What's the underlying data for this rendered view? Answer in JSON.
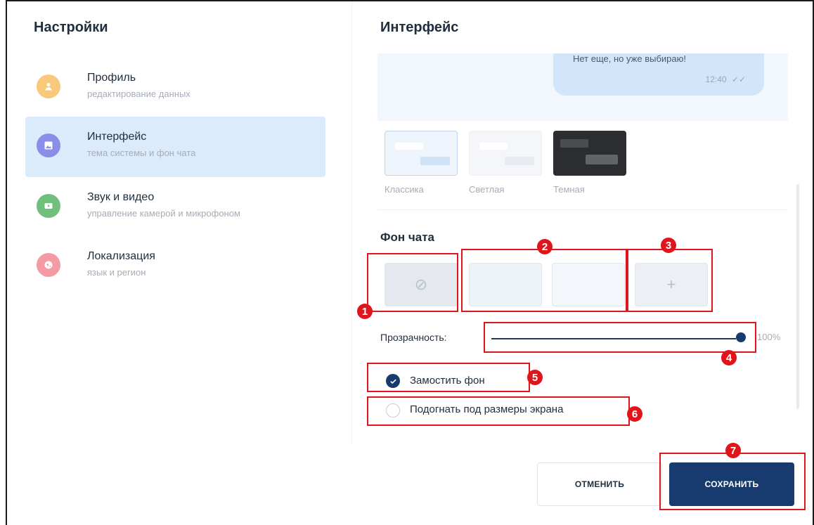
{
  "left": {
    "title": "Настройки",
    "items": [
      {
        "title": "Профиль",
        "subtitle": "редактирование данных",
        "icon": "user-icon",
        "color": "#f8c97a"
      },
      {
        "title": "Интерфейс",
        "subtitle": "тема системы и фон чата",
        "icon": "image-icon",
        "color": "#8a8ee6"
      },
      {
        "title": "Звук и видео",
        "subtitle": "управление камерой и микрофоном",
        "icon": "video-icon",
        "color": "#6fc07a"
      },
      {
        "title": "Локализация",
        "subtitle": "язык и регион",
        "icon": "globe-icon",
        "color": "#f49aa2"
      }
    ]
  },
  "right": {
    "title": "Интерфейс",
    "preview": {
      "message": "Нет еще, но уже выбираю!",
      "time": "12:40"
    },
    "themes": [
      {
        "label": "Классика",
        "selected": true
      },
      {
        "label": "Светлая",
        "selected": false
      },
      {
        "label": "Темная",
        "selected": false
      }
    ],
    "chat_bg": {
      "title": "Фон чата",
      "transparency_label": "Прозрачность:",
      "transparency_value": "100%",
      "tile_option": "Замостить фон",
      "fit_option": "Подогнать под размеры экрана"
    }
  },
  "buttons": {
    "cancel": "ОТМЕНИТЬ",
    "save": "СОХРАНИТЬ"
  },
  "annotations": [
    "1",
    "2",
    "3",
    "4",
    "5",
    "6",
    "7"
  ],
  "colors": {
    "accent": "#173b6e",
    "highlight": "#e0141b",
    "active_bg": "#dcebfb"
  }
}
